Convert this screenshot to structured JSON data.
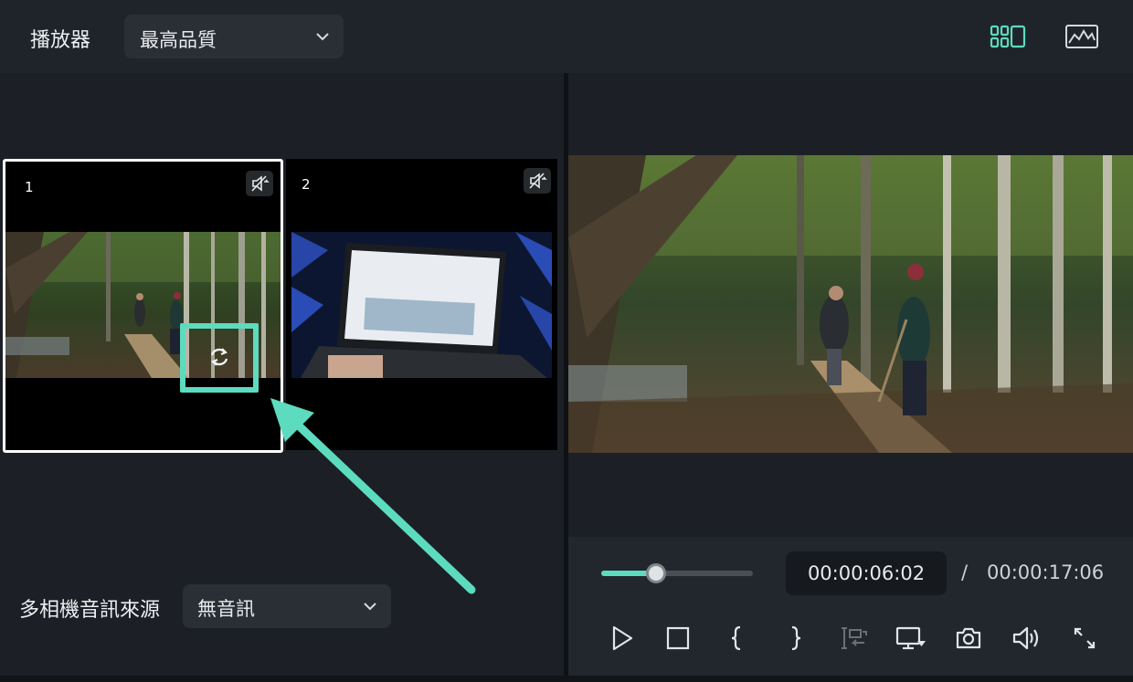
{
  "topbar": {
    "player_label": "播放器",
    "quality_value": "最高品質"
  },
  "multicam": {
    "cameras": [
      {
        "number": "1"
      },
      {
        "number": "2"
      }
    ],
    "audio_source_label": "多相機音訊來源",
    "audio_source_value": "無音訊"
  },
  "preview": {
    "current_time": "00:00:06:02",
    "time_separator": "/",
    "total_time": "00:00:17:06",
    "progress": 0.36
  },
  "colors": {
    "accent": "#5ddbbe",
    "panel_bg": "#1c2026",
    "topbar_bg": "#1f242b",
    "select_bg": "#2a2f36"
  },
  "icons": {
    "multicam_view": "multicam-grid-icon",
    "scope": "waveform-scope-icon",
    "audio_off": "speaker-muted-icon",
    "swap": "swap-icon",
    "play": "play-icon",
    "stop": "stop-icon",
    "mark_in": "mark-in-icon",
    "mark_out": "mark-out-icon",
    "insert": "insert-clip-icon",
    "display": "display-settings-icon",
    "snapshot": "camera-snapshot-icon",
    "volume": "volume-icon",
    "fullscreen": "fullscreen-icon"
  }
}
